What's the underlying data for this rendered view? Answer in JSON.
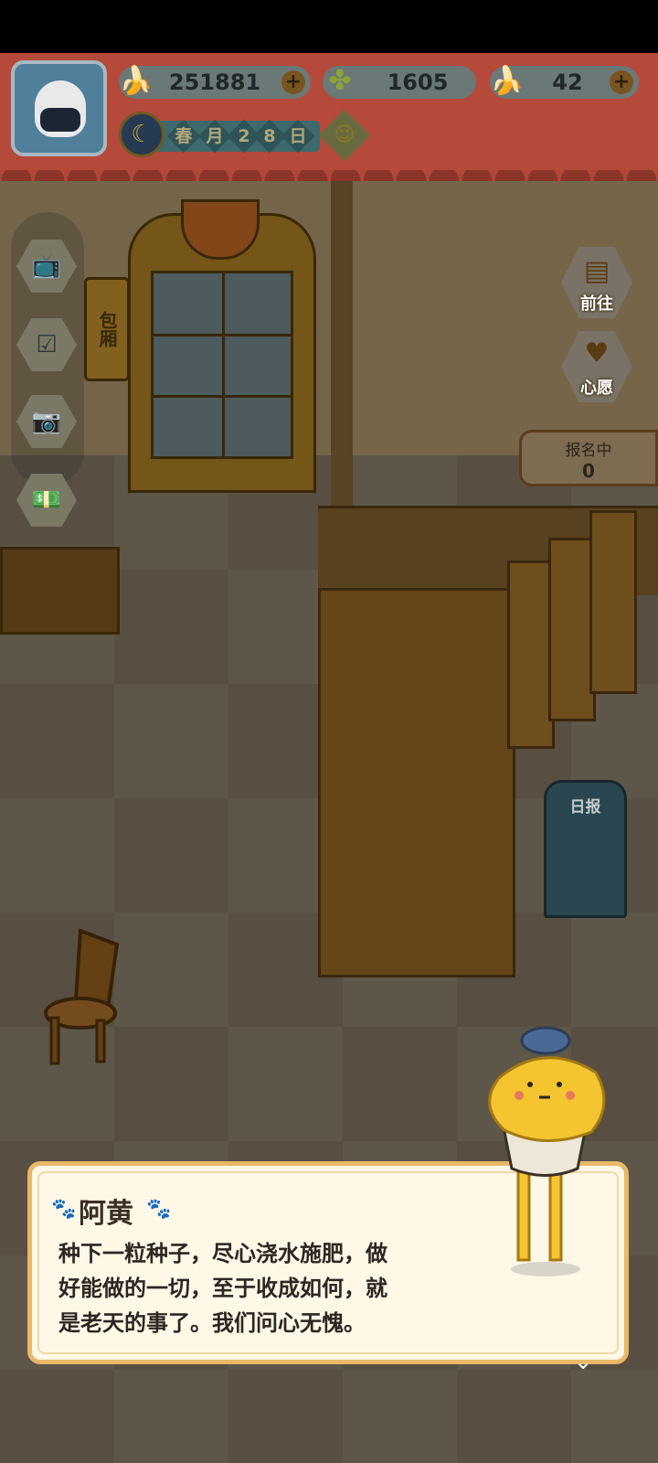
{
  "resources": {
    "banana": {
      "value": "251881",
      "icon": "banana-icon"
    },
    "clover": {
      "value": "1605",
      "icon": "clover-icon"
    },
    "blue_banana": {
      "value": "42",
      "icon": "blue-banana-icon"
    }
  },
  "calendar": {
    "chars": [
      "春",
      "月",
      "2",
      "8",
      "日"
    ],
    "weather_icon": "sun-icon",
    "moon_icon": "moon-icon"
  },
  "left_menu": [
    "tv-icon",
    "checklist-icon",
    "camera-icon",
    "money-icon"
  ],
  "right_menu": {
    "goto_label": "前往",
    "wish_label": "心愿"
  },
  "signup": {
    "label": "报名中",
    "count": "0"
  },
  "scene": {
    "room_sign": "包厢",
    "mailbox_label": "日报"
  },
  "dialog": {
    "speaker": "阿黄",
    "lines": [
      "种下一粒种子，尽心浇水施肥，做",
      "好能做的一切，至于收成如何，就",
      "是老天的事了。我们问心无愧。"
    ]
  },
  "colors": {
    "header_red": "#b54a3a",
    "dialog_bg": "#fff8e7",
    "dialog_border": "#e9b868",
    "dog_yellow": "#f5c431"
  }
}
